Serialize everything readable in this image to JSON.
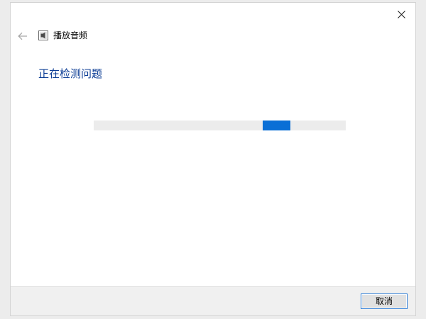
{
  "window": {
    "close_icon": "close-icon",
    "back_icon": "back-arrow-icon",
    "app_icon": "speaker-troubleshooter-icon",
    "app_title": "播放音频"
  },
  "main": {
    "heading": "正在检测问题",
    "progress": {
      "indeterminate": true,
      "segment_position_fraction": 0.67,
      "color": "#0a6fd6"
    }
  },
  "footer": {
    "cancel_label": "取消"
  },
  "colors": {
    "heading": "#0c3d95",
    "accent": "#0a6fd6",
    "button_border": "#2b7bd6"
  }
}
